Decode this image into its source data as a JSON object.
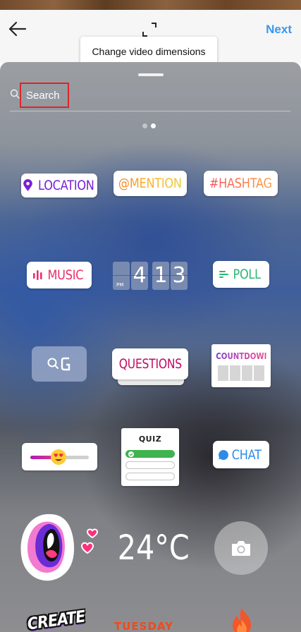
{
  "header": {
    "back_icon": "arrow-left-icon",
    "resize_icon": "expand-corners-icon",
    "next_label": "Next",
    "tooltip_text": "Change video dimensions",
    "accent_color": "#3897f0"
  },
  "tray": {
    "search": {
      "placeholder": "Search",
      "value": "",
      "highlight_color": "#d9262a"
    },
    "page_indicator": {
      "count": 2,
      "active": 2
    },
    "stickers": {
      "location": {
        "label": "LOCATION",
        "icon": "map-pin-icon"
      },
      "mention": {
        "label": "@MENTION"
      },
      "hashtag": {
        "label": "#HASHTAG"
      },
      "music": {
        "label": "MUSIC",
        "icon": "music-bars-icon"
      },
      "countdown_clock": {
        "digits": [
          "",
          "4",
          "1",
          "3"
        ],
        "small_label": "PM"
      },
      "poll": {
        "label": "POLL",
        "icon": "poll-lines-icon"
      },
      "gif": {
        "icon": "search-g-icon"
      },
      "questions": {
        "label": "QUESTIONS"
      },
      "countdown": {
        "label": "COUNTDOWN"
      },
      "emoji_slider": {
        "icon": "heart-eyes-emoji-icon",
        "level": 0.45
      },
      "quiz": {
        "label": "QUIZ"
      },
      "chat": {
        "label": "CHAT",
        "icon": "chat-bubble-icon"
      },
      "face": {
        "icon": "screaming-mouth-icon"
      },
      "temperature": {
        "label": "24°C"
      },
      "camera": {
        "icon": "camera-icon"
      },
      "create": {
        "label": "CREATE"
      },
      "day": {
        "label": "TUESDAY"
      },
      "fire": {
        "icon": "fire-icon"
      }
    }
  }
}
